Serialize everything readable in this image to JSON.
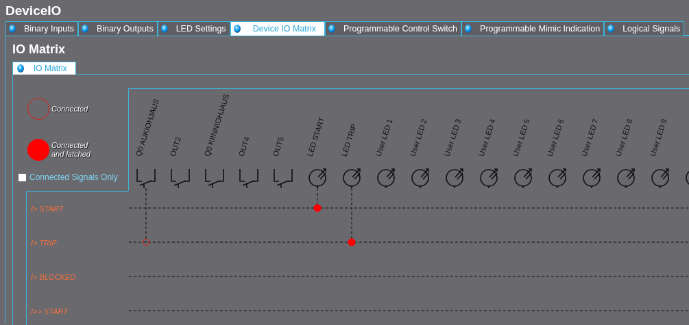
{
  "app_title": "DeviceIO",
  "tabs": [
    {
      "label": "Binary Inputs",
      "selected": false
    },
    {
      "label": "Binary Outputs",
      "selected": false
    },
    {
      "label": "LED Settings",
      "selected": false
    },
    {
      "label": "Device IO Matrix",
      "selected": true
    },
    {
      "label": "Programmable Control Switch",
      "selected": false
    },
    {
      "label": "Programmable Mimic Indication",
      "selected": false
    },
    {
      "label": "Logical Signals",
      "selected": false
    }
  ],
  "page_title": "IO Matrix",
  "subtabs": [
    {
      "label": "IO Matrix",
      "selected": true
    }
  ],
  "legend": [
    {
      "kind": "connected",
      "label": "Connected"
    },
    {
      "kind": "latched",
      "label": "Connected and latched"
    }
  ],
  "filter": {
    "label": "Connected Signals Only",
    "checked": false
  },
  "columns": [
    {
      "kind": "contact",
      "label": "Q0 AUKIOHJAUS"
    },
    {
      "kind": "contact",
      "label": "OUT2"
    },
    {
      "kind": "contact",
      "label": "Q0 KIINNIOHJAUS"
    },
    {
      "kind": "contact",
      "label": "OUT4"
    },
    {
      "kind": "contact",
      "label": "OUT5"
    },
    {
      "kind": "led",
      "label": "LED START"
    },
    {
      "kind": "led",
      "label": "LED TRIP"
    },
    {
      "kind": "led",
      "label": "User LED 1"
    },
    {
      "kind": "led",
      "label": "User LED 2"
    },
    {
      "kind": "led",
      "label": "User LED 3"
    },
    {
      "kind": "led",
      "label": "User LED 4"
    },
    {
      "kind": "led",
      "label": "User LED 5"
    },
    {
      "kind": "led",
      "label": "User LED 6"
    },
    {
      "kind": "led",
      "label": "User LED 7"
    },
    {
      "kind": "led",
      "label": "User LED 8"
    },
    {
      "kind": "led",
      "label": "User LED 9"
    },
    {
      "kind": "led"
    }
  ],
  "signals": [
    {
      "label": "I> START",
      "cells": [
        {
          "kind": "empty"
        },
        {
          "kind": "empty"
        },
        {
          "kind": "empty"
        },
        {
          "kind": "empty"
        },
        {
          "kind": "empty"
        },
        {
          "kind": "latched"
        },
        {
          "kind": "empty"
        },
        {
          "kind": "empty"
        },
        {
          "kind": "empty"
        },
        {
          "kind": "empty"
        },
        {
          "kind": "empty"
        },
        {
          "kind": "empty"
        },
        {
          "kind": "empty"
        },
        {
          "kind": "empty"
        },
        {
          "kind": "empty"
        },
        {
          "kind": "empty"
        },
        {
          "kind": "empty"
        }
      ]
    },
    {
      "label": "I> TRIP",
      "cells": [
        {
          "kind": "connected"
        },
        {
          "kind": "empty"
        },
        {
          "kind": "empty"
        },
        {
          "kind": "empty"
        },
        {
          "kind": "empty"
        },
        {
          "kind": "empty"
        },
        {
          "kind": "latched"
        },
        {
          "kind": "empty"
        },
        {
          "kind": "empty"
        },
        {
          "kind": "empty"
        },
        {
          "kind": "empty"
        },
        {
          "kind": "empty"
        },
        {
          "kind": "empty"
        },
        {
          "kind": "empty"
        },
        {
          "kind": "empty"
        },
        {
          "kind": "empty"
        },
        {
          "kind": "empty"
        }
      ]
    },
    {
      "label": "I> BLOCKED",
      "cells": [
        {
          "kind": "empty"
        },
        {
          "kind": "empty"
        },
        {
          "kind": "empty"
        },
        {
          "kind": "empty"
        },
        {
          "kind": "empty"
        },
        {
          "kind": "empty"
        },
        {
          "kind": "empty"
        },
        {
          "kind": "empty"
        },
        {
          "kind": "empty"
        },
        {
          "kind": "empty"
        },
        {
          "kind": "empty"
        },
        {
          "kind": "empty"
        },
        {
          "kind": "empty"
        },
        {
          "kind": "empty"
        },
        {
          "kind": "empty"
        },
        {
          "kind": "empty"
        },
        {
          "kind": "empty"
        }
      ]
    },
    {
      "label": "I>> START",
      "cells": [
        {
          "kind": "empty"
        },
        {
          "kind": "empty"
        },
        {
          "kind": "empty"
        },
        {
          "kind": "empty"
        },
        {
          "kind": "empty"
        },
        {
          "kind": "empty"
        },
        {
          "kind": "empty"
        },
        {
          "kind": "empty"
        },
        {
          "kind": "empty"
        },
        {
          "kind": "empty"
        },
        {
          "kind": "empty"
        },
        {
          "kind": "empty"
        },
        {
          "kind": "empty"
        },
        {
          "kind": "empty"
        },
        {
          "kind": "empty"
        },
        {
          "kind": "empty"
        },
        {
          "kind": "empty"
        }
      ]
    }
  ]
}
